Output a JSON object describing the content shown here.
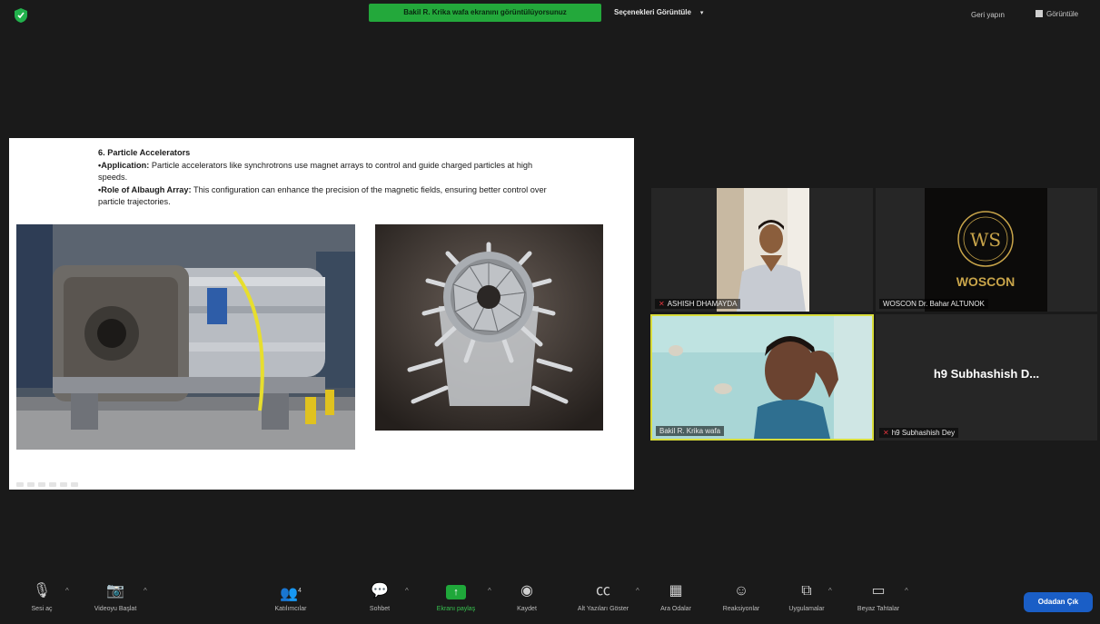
{
  "topbar": {
    "share_banner": "Bakil R. Krika wafa ekranını görüntülüyorsunuz",
    "view_options": "Seçenekleri Görüntüle",
    "exit_fullscreen": "Geri yapın",
    "view": "Görüntüle"
  },
  "slide": {
    "heading": "6. Particle Accelerators",
    "application_label": "•Application:",
    "application_text": " Particle accelerators like synchrotrons use magnet arrays to control and guide charged particles at high speeds.",
    "role_label": "•Role of Albaugh Array:",
    "role_text": " This configuration can enhance the precision of the magnetic fields, ensuring better control over particle trajectories."
  },
  "participants": [
    {
      "name": "ASHISH DHAMAYDA",
      "muted": true
    },
    {
      "name": "WOSCON Dr. Bahar ALTUNOK",
      "muted": false,
      "logo_text": "WOSCON",
      "logo_monogram": "WS"
    },
    {
      "name": "Bakil R. Krika wafa",
      "muted": false,
      "active_speaker": true
    },
    {
      "name": "h9 Subhashish Dey",
      "display_name": "h9 Subhashish D...",
      "muted": true
    }
  ],
  "toolbar": {
    "mute": "Sesi aç",
    "video": "Videoyu Başlat",
    "participants": "Katılımcılar",
    "participant_count": "4",
    "chat": "Sohbet",
    "share": "Ekranı paylaş",
    "record": "Kaydet",
    "captions": "Alt Yazıları Göster",
    "breakout": "Ara Odalar",
    "reactions": "Reaksiyonlar",
    "apps": "Uygulamalar",
    "whiteboard": "Beyaz Tahtalar",
    "leave": "Odadan Çık"
  },
  "colors": {
    "share_green": "#23a83b",
    "active_speaker": "#d8dc3a",
    "leave_blue": "#1a5ec6",
    "muted_red": "#e0353d"
  }
}
